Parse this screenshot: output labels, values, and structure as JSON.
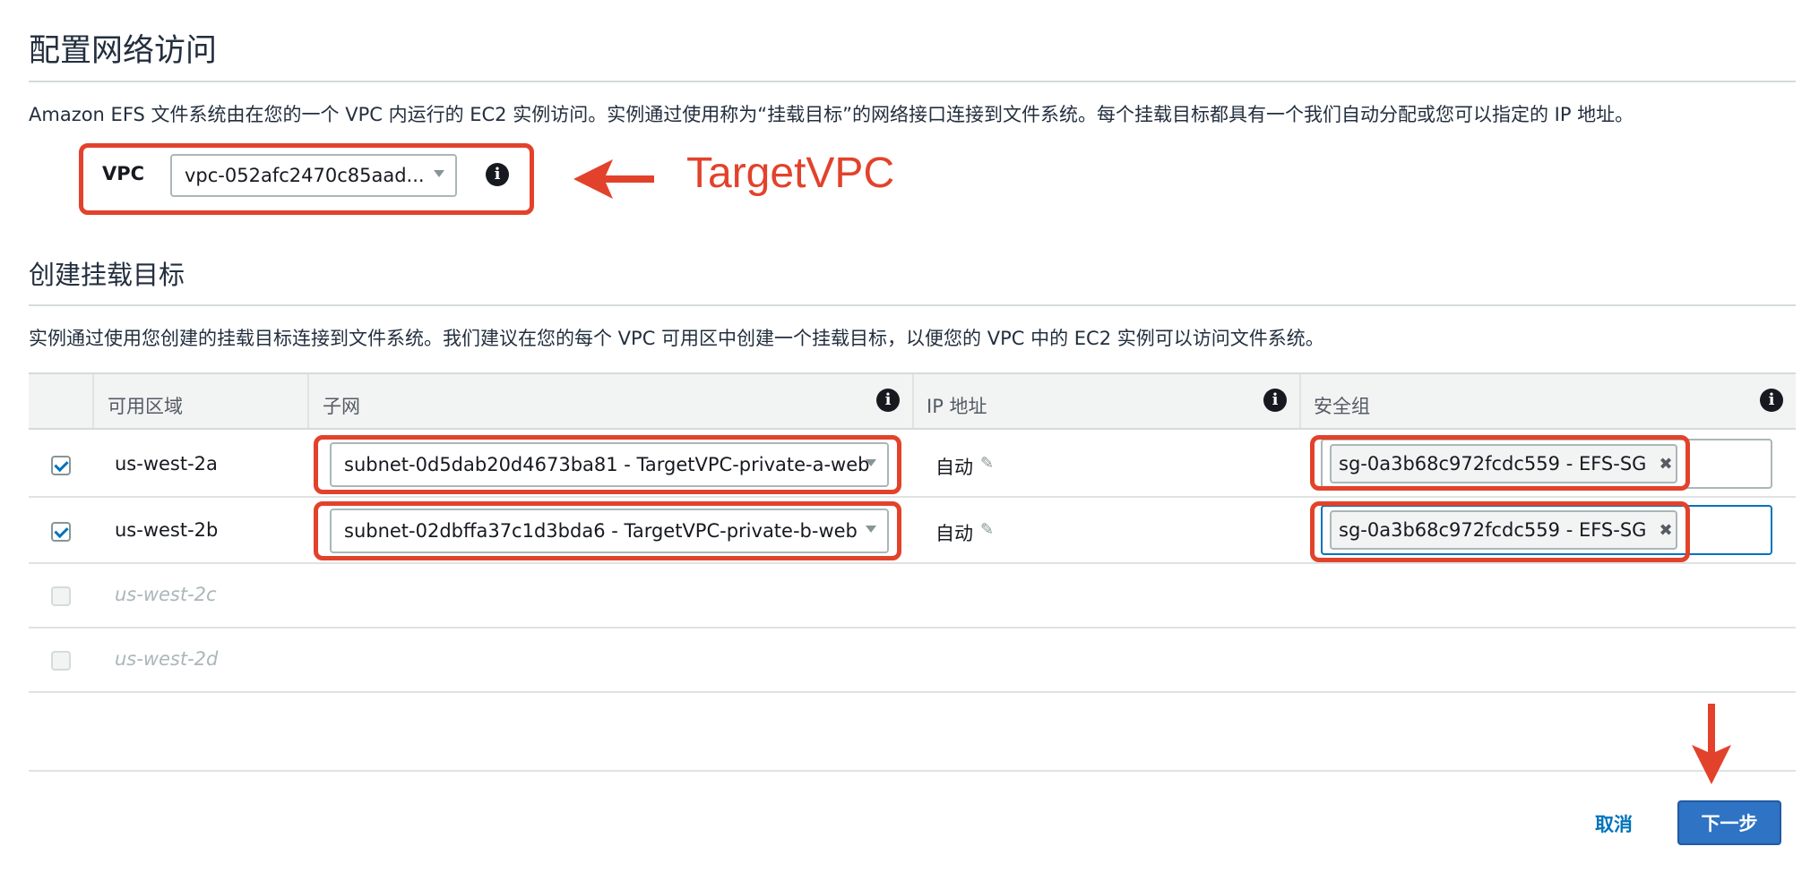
{
  "network": {
    "title": "配置网络访问",
    "description": "Amazon EFS 文件系统由在您的一个 VPC 内运行的 EC2 实例访问。实例通过使用称为“挂载目标”的网络接口连接到文件系统。每个挂载目标都具有一个我们自动分配或您可以指定的 IP 地址。",
    "vpc_label": "VPC",
    "vpc_value": "vpc-052afc2470c85aad..."
  },
  "annotation": {
    "label": "TargetVPC",
    "color": "#e2422b"
  },
  "mount": {
    "title": "创建挂载目标",
    "description": "实例通过使用您创建的挂载目标连接到文件系统。我们建议在您的每个 VPC 可用区中创建一个挂载目标，以便您的 VPC 中的 EC2 实例可以访问文件系统。",
    "columns": {
      "zone": "可用区域",
      "subnet": "子网",
      "ip": "IP 地址",
      "sg": "安全组"
    },
    "rows": [
      {
        "checked": true,
        "zone": "us-west-2a",
        "subnet": "subnet-0d5dab20d4673ba81 - TargetVPC-private-a-web",
        "ip": "自动",
        "sg": "sg-0a3b68c972fcdc559 - EFS-SG"
      },
      {
        "checked": true,
        "zone": "us-west-2b",
        "subnet": "subnet-02dbffa37c1d3bda6 - TargetVPC-private-b-web",
        "ip": "自动",
        "sg": "sg-0a3b68c972fcdc559 - EFS-SG"
      },
      {
        "checked": false,
        "zone": "us-west-2c"
      },
      {
        "checked": false,
        "zone": "us-west-2d"
      }
    ]
  },
  "footer": {
    "cancel": "取消",
    "next": "下一步"
  },
  "colors": {
    "accent": "#0073bb",
    "primary_button": "#2e73c4",
    "highlight": "#e2422b"
  }
}
